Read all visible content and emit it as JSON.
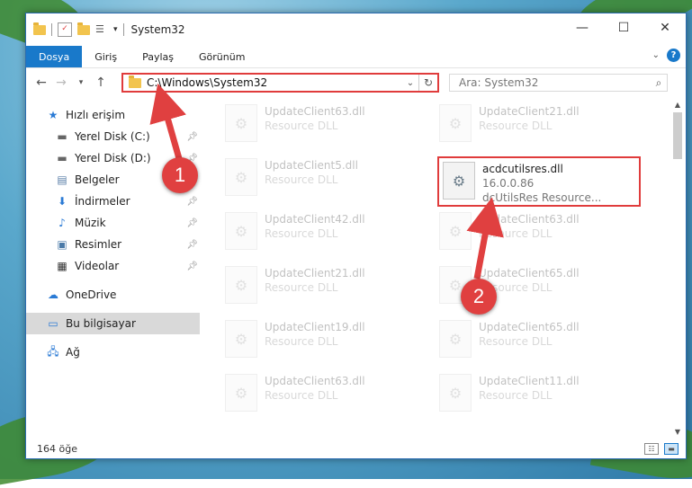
{
  "window": {
    "title": "System32",
    "controls": {
      "minimize": "—",
      "maximize": "☐",
      "close": "✕"
    }
  },
  "ribbon": {
    "tabs": [
      {
        "label": "Dosya",
        "active": true
      },
      {
        "label": "Giriş"
      },
      {
        "label": "Paylaş"
      },
      {
        "label": "Görünüm"
      }
    ],
    "help_label": "?"
  },
  "nav": {
    "address": "C:\\Windows\\System32",
    "search_placeholder": "Ara: System32"
  },
  "sidebar": {
    "items": [
      {
        "label": "Hızlı erişim",
        "icon": "star-icon"
      },
      {
        "label": "Yerel Disk (C:)",
        "icon": "drive-icon",
        "pinned": true
      },
      {
        "label": "Yerel Disk (D:)",
        "icon": "drive-icon",
        "pinned": true
      },
      {
        "label": "Belgeler",
        "icon": "documents-icon",
        "pinned": true
      },
      {
        "label": "İndirmeler",
        "icon": "downloads-icon",
        "pinned": true
      },
      {
        "label": "Müzik",
        "icon": "music-icon",
        "pinned": true
      },
      {
        "label": "Resimler",
        "icon": "pictures-icon",
        "pinned": true
      },
      {
        "label": "Videolar",
        "icon": "videos-icon",
        "pinned": true
      },
      {
        "label": "OneDrive",
        "icon": "onedrive-icon"
      },
      {
        "label": "Bu bilgisayar",
        "icon": "computer-icon",
        "selected": true
      },
      {
        "label": "Ağ",
        "icon": "network-icon"
      }
    ]
  },
  "files": {
    "left_column": [
      {
        "name": "UpdateClient63.dll",
        "desc": "Resource DLL"
      },
      {
        "name": "UpdateClient5.dll",
        "desc": "Resource DLL"
      },
      {
        "name": "UpdateClient42.dll",
        "desc": "Resource DLL"
      },
      {
        "name": "UpdateClient21.dll",
        "desc": "Resource DLL"
      },
      {
        "name": "UpdateClient19.dll",
        "desc": "Resource DLL"
      },
      {
        "name": "UpdateClient63.dll",
        "desc": "Resource DLL"
      }
    ],
    "right_column": [
      {
        "name": "UpdateClient21.dll",
        "desc": "Resource DLL"
      },
      {
        "name": "UpdateClient63.dll",
        "desc": "Resource DLL"
      },
      {
        "name": "UpdateClient65.dll",
        "desc": "Resource DLL"
      },
      {
        "name": "UpdateClient65.dll",
        "desc": "Resource DLL"
      },
      {
        "name": "UpdateClient11.dll",
        "desc": "Resource DLL"
      }
    ],
    "highlighted": {
      "name": "acdcutilsres.dll",
      "version": "16.0.0.86",
      "desc": "dcUtilsRes Resource..."
    }
  },
  "status": {
    "item_count": "164 öğe"
  },
  "annotations": {
    "badge1": "1",
    "badge2": "2",
    "color": "#e04040"
  }
}
